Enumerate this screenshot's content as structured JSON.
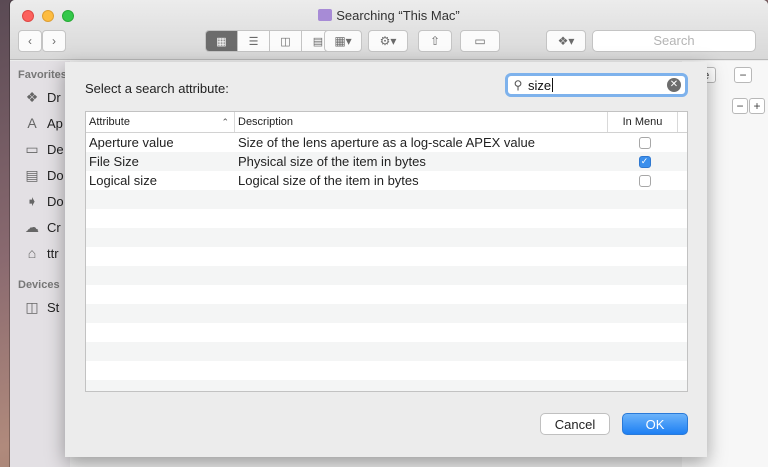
{
  "window": {
    "title": "Searching “This Mac”",
    "toolbar_search_placeholder": "Search"
  },
  "sidebar": {
    "favorites_heading": "Favorites",
    "devices_heading": "Devices",
    "items": [
      {
        "label": "Dr",
        "icon": "dropbox-icon"
      },
      {
        "label": "Ap",
        "icon": "applications-icon"
      },
      {
        "label": "De",
        "icon": "desktop-icon"
      },
      {
        "label": "Do",
        "icon": "documents-icon"
      },
      {
        "label": "Do",
        "icon": "downloads-icon"
      },
      {
        "label": "Cr",
        "icon": "creative-cloud-icon"
      },
      {
        "label": "ttr",
        "icon": "home-icon"
      }
    ],
    "device_items": [
      {
        "label": "St",
        "icon": "disk-icon"
      }
    ]
  },
  "right_pane": {
    "save_label": "ve",
    "minus_label": "−",
    "plus_label": "+"
  },
  "sheet": {
    "prompt": "Select a search attribute:",
    "search_value": "size",
    "columns": [
      "Attribute",
      "Description",
      "In Menu"
    ],
    "rows": [
      {
        "attribute": "Aperture value",
        "description": "Size of the lens aperture as a log-scale APEX value",
        "in_menu": false
      },
      {
        "attribute": "File Size",
        "description": "Physical size of the item in bytes",
        "in_menu": true
      },
      {
        "attribute": "Logical size",
        "description": "Logical size of the item in bytes",
        "in_menu": false
      }
    ],
    "cancel_label": "Cancel",
    "ok_label": "OK"
  },
  "colors": {
    "accent": "#3b8fec",
    "ok_button": "#1d7ff3",
    "search_focus_ring": "#7eb2ec"
  }
}
